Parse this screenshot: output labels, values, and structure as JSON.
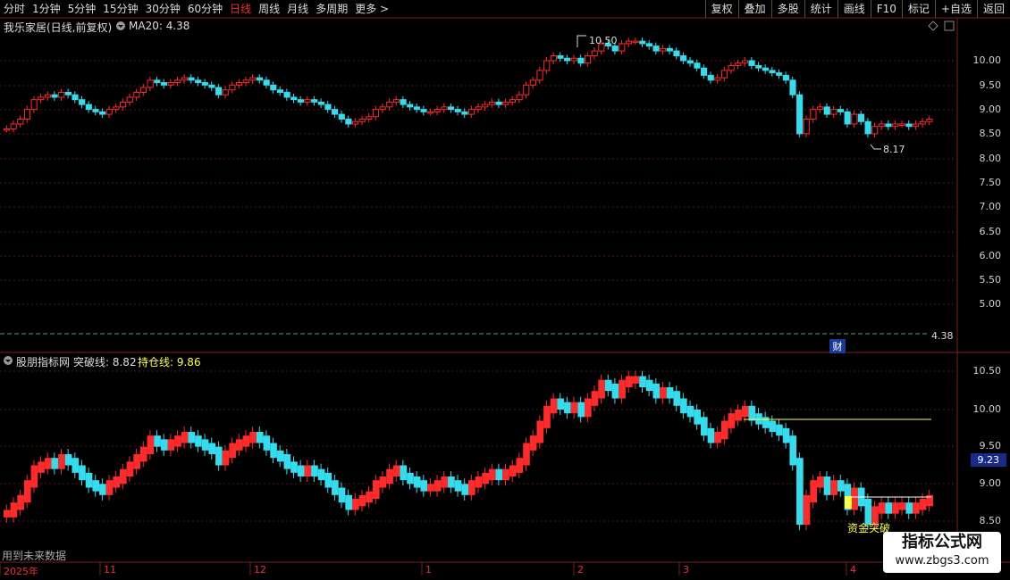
{
  "toolbar": {
    "periods": [
      "分时",
      "1分钟",
      "5分钟",
      "15分钟",
      "30分钟",
      "60分钟",
      "日线",
      "周线",
      "月线",
      "多周期",
      "更多 >"
    ],
    "active_period": "日线",
    "right_buttons": [
      "复权",
      "叠加",
      "多股",
      "统计",
      "画线",
      "F10",
      "标记",
      "+自选",
      "返回"
    ]
  },
  "main_panel": {
    "title": "我乐家居(日线,前复权)",
    "ma_label": "MA20: 4.38",
    "y_ticks": [
      "10.00",
      "9.50",
      "9.00",
      "8.50",
      "8.00",
      "7.50",
      "7.00",
      "6.50",
      "6.00",
      "5.50",
      "5.00"
    ],
    "high_marker": "10.50",
    "low_marker": "8.17",
    "ma_value": "4.38",
    "cai_badge": "财"
  },
  "indicator_panel": {
    "name": "股朋指标网",
    "breakout_label": "突破线: 8.82",
    "hold_label": "持仓线: 9.86",
    "y_ticks": [
      "10.50",
      "10.00",
      "9.50",
      "9.00",
      "8.50"
    ],
    "current_value": "9.23",
    "signal_text": "资金突破",
    "footer_note": "用到未来数据"
  },
  "time_axis": {
    "labels": [
      "2025年",
      "11",
      "12",
      "1",
      "2",
      "3",
      "4"
    ]
  },
  "watermark": {
    "line1": "指标公式网",
    "line2": "www.zbgs3.com"
  },
  "colors": {
    "up": "#ff2a2a",
    "down": "#33ddee",
    "grid": "#551818",
    "yellow": "#ffff44",
    "ma_line": "#55aa66"
  }
}
